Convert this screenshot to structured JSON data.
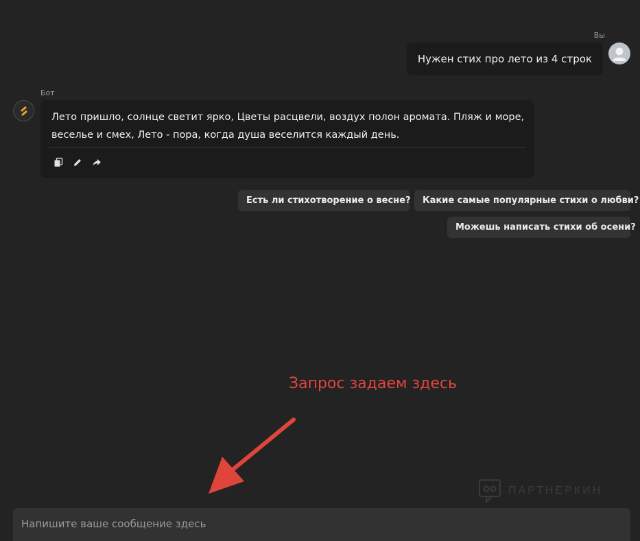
{
  "user": {
    "name": "Вы",
    "message": "Нужен стих про лето из 4 строк"
  },
  "bot": {
    "name": "Бот",
    "message": "Лето пришло, солнце светит ярко, Цветы расцвели, воздух полон аромата. Пляж и море, веселье и смех, Лето - пора, когда душа веселится каждый день.",
    "actions": [
      "copy-icon",
      "edit-icon",
      "share-icon"
    ]
  },
  "suggestions": [
    "Есть ли стихотворение о весне?",
    "Какие самые популярные стихи о любви?",
    "Можешь написать стихи об осени?"
  ],
  "annotation": {
    "text": "Запрос задаем здесь",
    "color": "#e0453c"
  },
  "watermark": {
    "text": "ПАРТНЕРКИН"
  },
  "input": {
    "placeholder": "Напишите ваше сообщение здесь"
  },
  "colors": {
    "background": "#232323",
    "bubble": "#1b1b1b",
    "chip": "#333333",
    "accent": "#f5a623"
  }
}
